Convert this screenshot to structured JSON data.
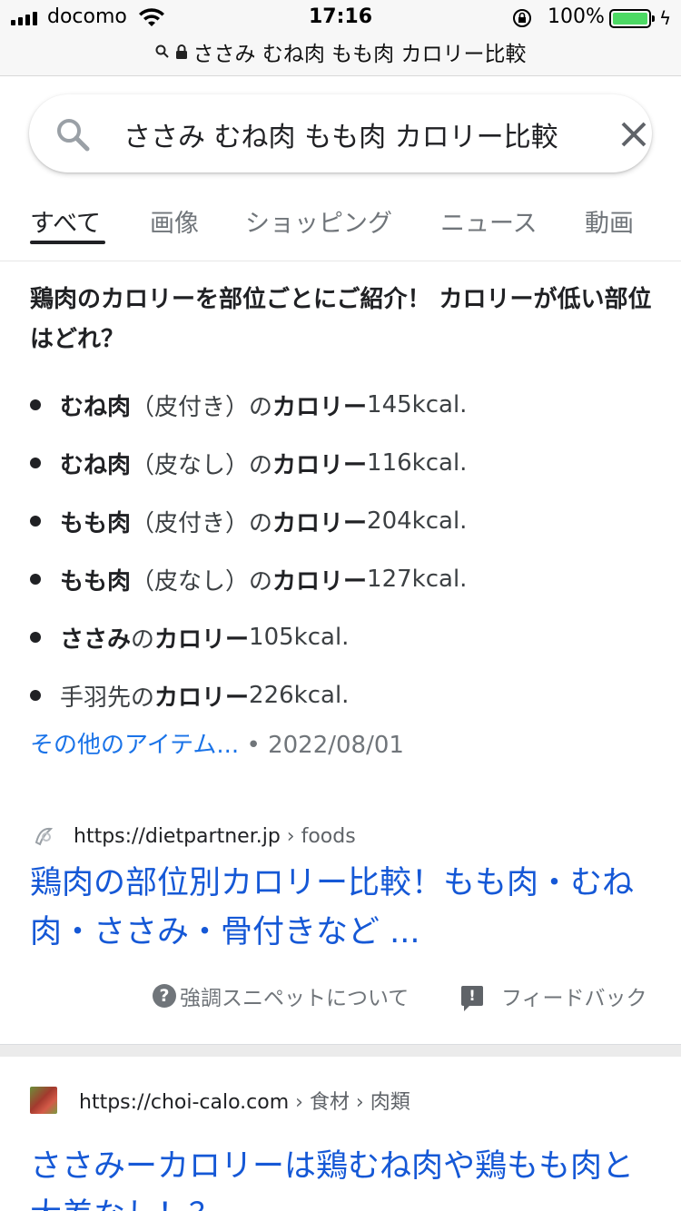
{
  "status_bar": {
    "carrier": "docomo",
    "time": "17:16",
    "battery_percent": "100%"
  },
  "address_bar": {
    "url_text": "ささみ むね肉 もも肉 カロリー比較"
  },
  "search": {
    "query": "ささみ むね肉 もも肉 カロリー比較"
  },
  "tabs": [
    {
      "label": "すべて",
      "active": true
    },
    {
      "label": "画像",
      "active": false
    },
    {
      "label": "ショッピング",
      "active": false
    },
    {
      "label": "ニュース",
      "active": false
    },
    {
      "label": "動画",
      "active": false
    }
  ],
  "snippet": {
    "title": "鶏肉のカロリーを部位ごとにご紹介！ カロリーが低い部位はどれ？",
    "items": [
      {
        "bold1": "むね肉",
        "normal": "（皮付き）の",
        "bold2": "カロリー",
        "value": " 145kcal."
      },
      {
        "bold1": "むね肉",
        "normal": "（皮なし）の",
        "bold2": "カロリー",
        "value": " 116kcal."
      },
      {
        "bold1": "もも肉",
        "normal": "（皮付き）の",
        "bold2": "カロリー",
        "value": " 204kcal."
      },
      {
        "bold1": "もも肉",
        "normal": "（皮なし）の",
        "bold2": "カロリー",
        "value": " 127kcal."
      },
      {
        "bold1": "ささみ",
        "normal": "の",
        "bold2": "カロリー",
        "value": " 105kcal."
      },
      {
        "bold1": "",
        "normal": "手羽先の",
        "bold2": "カロリー",
        "value": " 226kcal."
      }
    ],
    "more_link": "その他のアイテム...",
    "separator": " • ",
    "date": "2022/08/01"
  },
  "result1": {
    "domain": "https://dietpartner.jp",
    "breadcrumb": " › foods",
    "title": "鶏肉の部位別カロリー比較！もも肉・むね肉・ささみ・骨付きなど ..."
  },
  "footer": {
    "about_snippet": "強調スニペットについて",
    "feedback": "フィードバック"
  },
  "result2": {
    "domain": "https://choi-calo.com",
    "breadcrumb": " › 食材 › 肉類",
    "title": "ささみーカロリーは鶏むね肉や鶏もも肉と大差なし！？"
  },
  "colors": {
    "link_blue": "#1558d6",
    "more_link_blue": "#1a73e8",
    "battery_green": "#4cd964"
  }
}
